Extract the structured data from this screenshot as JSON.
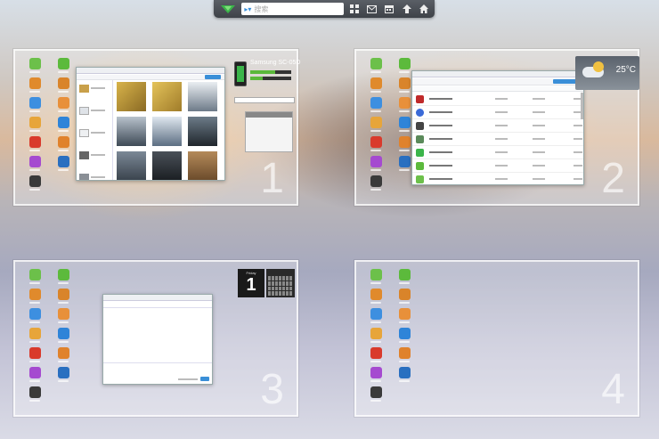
{
  "toolbar": {
    "search_placeholder": "搜索",
    "icons": [
      "logo-icon",
      "apps-grid-icon",
      "mail-icon",
      "calendar-icon",
      "upload-icon",
      "home-icon"
    ]
  },
  "screens": [
    {
      "number": "1"
    },
    {
      "number": "2"
    },
    {
      "number": "3"
    },
    {
      "number": "4"
    }
  ],
  "device": {
    "name": "Samsung SC-05D"
  },
  "weather": {
    "temperature": "25°C"
  },
  "calendar": {
    "day": "1",
    "weekday": "Friday"
  },
  "colors": {
    "accent": "#3a8fd8",
    "brand_green": "#3bb54a"
  }
}
